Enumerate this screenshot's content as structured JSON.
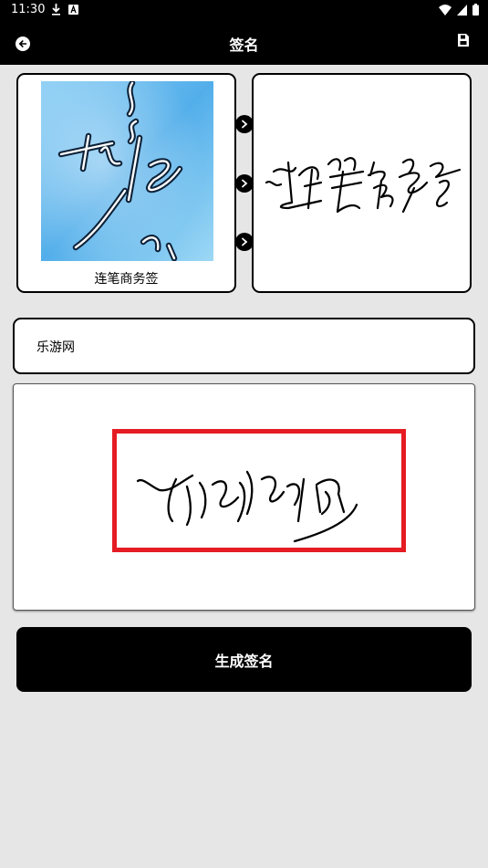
{
  "status_bar": {
    "time": "11:30",
    "icons": [
      "download-icon",
      "a-badge-icon",
      "wifi-icon",
      "signal-icon",
      "battery-icon"
    ]
  },
  "app_bar": {
    "title": "签名",
    "back_icon": "arrow-left-circle-icon",
    "save_icon": "save-icon"
  },
  "style_picker": {
    "selected_style_label": "连笔商务签",
    "next_icons": [
      "chevron-right-icon",
      "chevron-right-icon",
      "chevron-right-icon"
    ]
  },
  "name_input": {
    "value": "乐游网"
  },
  "result": {
    "frame_color": "#e51c23"
  },
  "generate_button": {
    "label": "生成签名"
  },
  "colors": {
    "background": "#e6e6e6",
    "bar": "#000000",
    "accent_red": "#e51c23"
  }
}
